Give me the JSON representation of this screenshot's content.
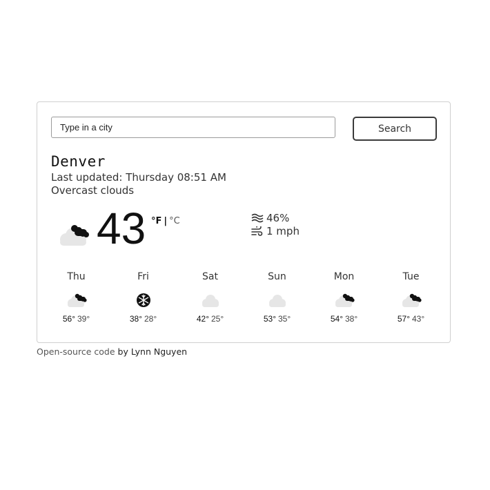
{
  "search": {
    "placeholder": "Type in a city",
    "button_label": "Search"
  },
  "current": {
    "city": "Denver",
    "last_updated": "Last updated: Thursday 08:51 AM",
    "description": "Overcast clouds",
    "temperature": "43",
    "icon": "overcast-clouds-icon",
    "unit_f": "°F",
    "unit_separator": "|",
    "unit_c": "°C",
    "humidity": "46%",
    "wind": "1 mph"
  },
  "forecast": [
    {
      "day": "Thu",
      "high": "56°",
      "low": "39°",
      "icon": "overcast-clouds-icon"
    },
    {
      "day": "Fri",
      "high": "38°",
      "low": "28°",
      "icon": "snowflake-icon"
    },
    {
      "day": "Sat",
      "high": "42°",
      "low": "25°",
      "icon": "cloud-icon"
    },
    {
      "day": "Sun",
      "high": "53°",
      "low": "35°",
      "icon": "cloud-icon"
    },
    {
      "day": "Mon",
      "high": "54°",
      "low": "38°",
      "icon": "overcast-clouds-icon"
    },
    {
      "day": "Tue",
      "high": "57°",
      "low": "43°",
      "icon": "overcast-clouds-icon"
    }
  ],
  "footer": {
    "link_text": "Open-source code",
    "author_text": "by Lynn Nguyen"
  }
}
